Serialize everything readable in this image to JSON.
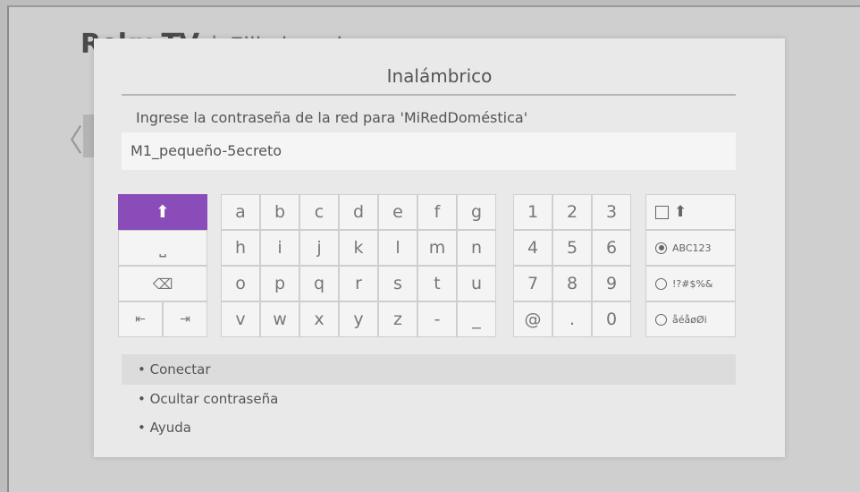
{
  "background": {
    "logo": "Roku TV",
    "separator": "|",
    "title": "Elija la red"
  },
  "dialog": {
    "title": "Inalámbrico",
    "prompt": "Ingrese la contraseña de la red para 'MiRedDoméstica'",
    "password_value": "M1_pequeño-5ecreto"
  },
  "keyboard": {
    "left_keys": {
      "shift": "⬆",
      "space": "⎵",
      "backspace": "⌫",
      "cursor_left": "⇤",
      "cursor_right": "⇥"
    },
    "letters": [
      "a",
      "b",
      "c",
      "d",
      "e",
      "f",
      "g",
      "h",
      "i",
      "j",
      "k",
      "l",
      "m",
      "n",
      "o",
      "p",
      "q",
      "r",
      "s",
      "t",
      "u",
      "v",
      "w",
      "x",
      "y",
      "z",
      "-",
      "_"
    ],
    "numbers": [
      "1",
      "2",
      "3",
      "4",
      "5",
      "6",
      "7",
      "8",
      "9",
      "@",
      ".",
      "0"
    ],
    "modes": {
      "caps": "⬆",
      "abc": "ABC123",
      "symbols": "!?#$%&",
      "accents": "åéåøØi"
    },
    "accent_color": "#8a4cb8"
  },
  "menu": {
    "connect": "• Conectar",
    "hide_password": "• Ocultar contraseña",
    "help": "• Ayuda"
  }
}
